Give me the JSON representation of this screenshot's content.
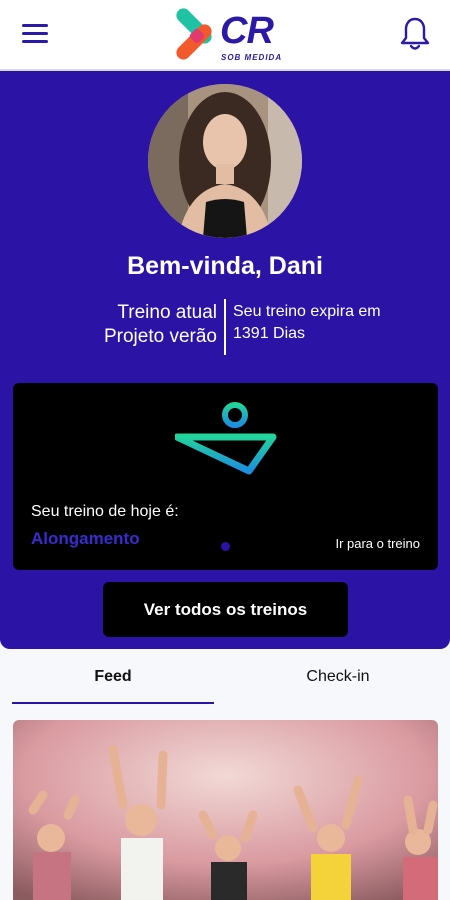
{
  "header": {
    "logo_text": "CR",
    "logo_subtitle": "SOB MEDIDA"
  },
  "hero": {
    "greeting": "Bem-vinda, Dani",
    "plan_left": [
      "Treino atual",
      "Projeto verão"
    ],
    "plan_right": [
      "Seu treino expira em",
      "1391 Dias"
    ]
  },
  "today": {
    "label": "Seu treino de hoje é:",
    "name": "Alongamento",
    "link": "Ir para o treino"
  },
  "all_workouts_button": "Ver todos os treinos",
  "tabs": [
    {
      "label": "Feed",
      "active": true
    },
    {
      "label": "Check-in",
      "active": false
    }
  ],
  "colors": {
    "brand": "#2b13a5",
    "accent_teal": "#1fc3a4",
    "accent_orange": "#f25a2c"
  }
}
